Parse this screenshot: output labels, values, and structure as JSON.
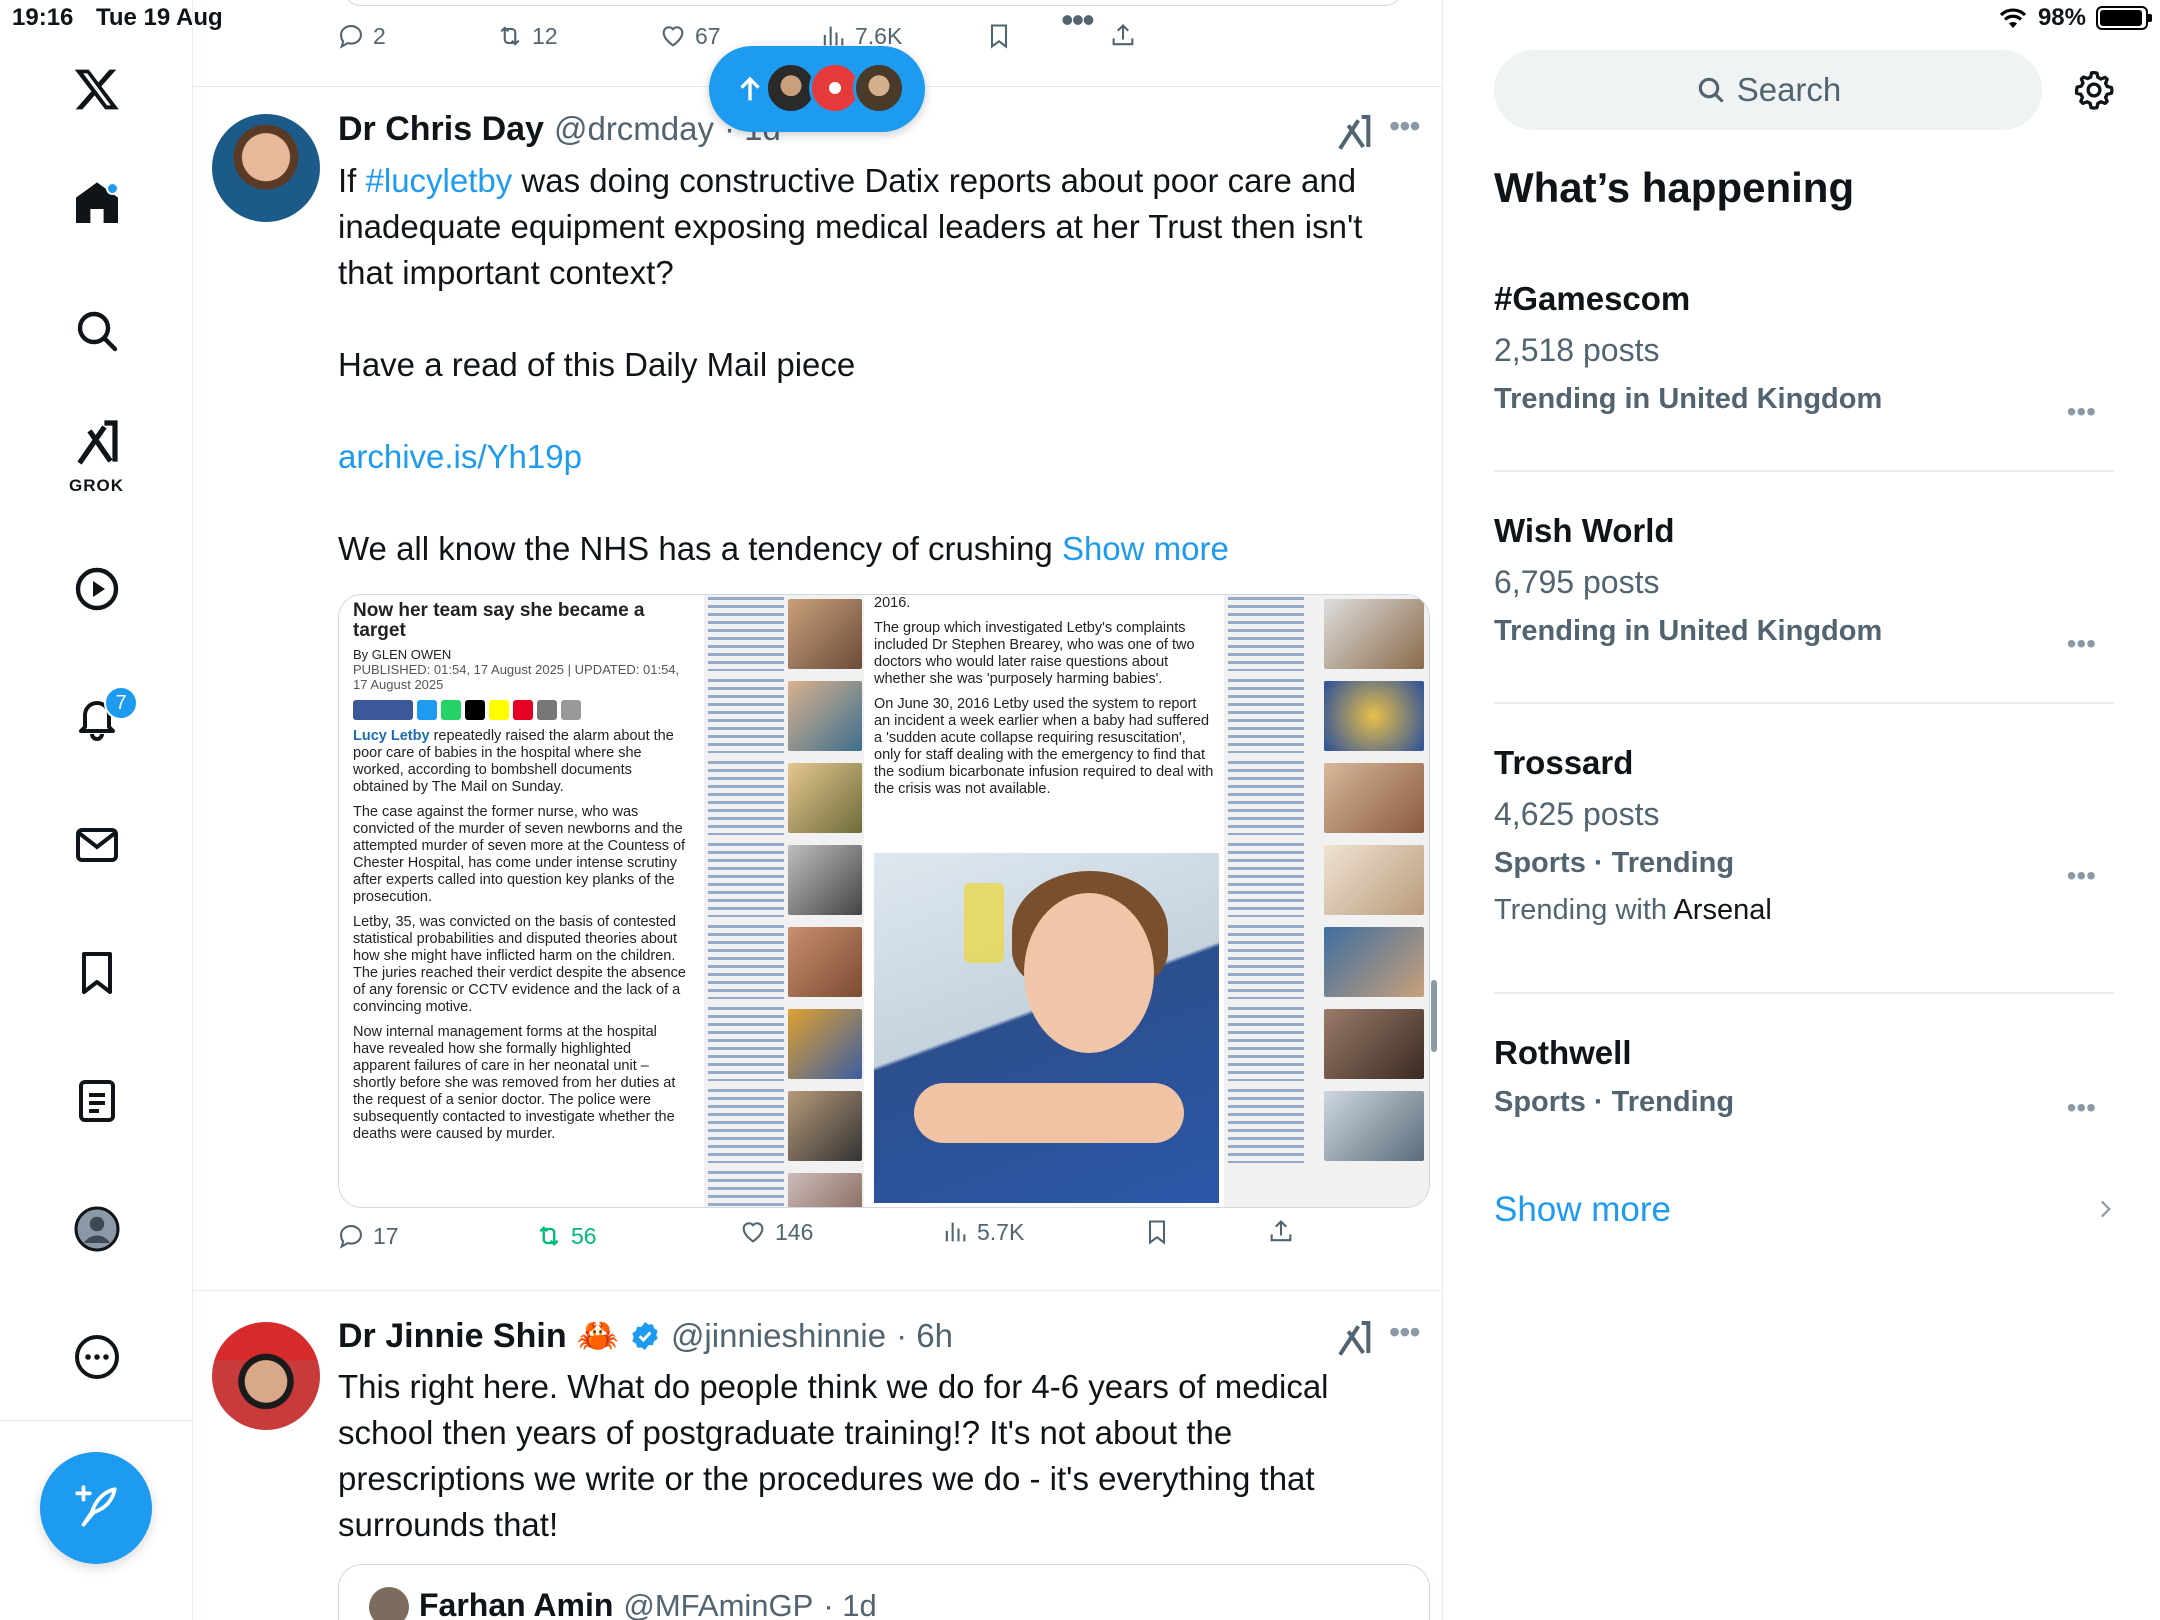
{
  "status_bar": {
    "time": "19:16",
    "date": "Tue 19 Aug",
    "battery": "98%",
    "battery_level": 0.98
  },
  "nav": {
    "grok_label": "GROK",
    "notifications_count": "7",
    "items": [
      "x-logo",
      "home-icon",
      "search-icon",
      "grok-icon",
      "video-icon",
      "bell-icon",
      "mail-icon",
      "bookmark-icon",
      "list-icon",
      "profile-icon",
      "more-icon"
    ]
  },
  "prev_tweet": {
    "replies": "2",
    "reposts": "12",
    "likes": "67",
    "views": "7.6K"
  },
  "tweet1": {
    "name": "Dr Chris Day",
    "handle": "@drcmday",
    "time": "· 1d",
    "text_before_hashtag": "If ",
    "hashtag": "#lucyletby",
    "text_after_hashtag": " was doing constructive Datix reports about poor care and inadequate equipment exposing medical leaders at her Trust then isn't that important context?",
    "para2": "Have a read of this Daily Mail piece",
    "link": "archive.is/Yh19p",
    "para4": "We all know the NHS has a tendency of crushing ",
    "show_more": "Show more",
    "replies": "17",
    "reposts": "56",
    "likes": "146",
    "views": "5.7K",
    "media": {
      "headline": "Now her team say she became a target",
      "byline": "By GLEN OWEN",
      "published": "PUBLISHED: 01:54, 17 August 2025 | UPDATED: 01:54, 17 August 2025",
      "p1_name": "Lucy Letby",
      "p1": " repeatedly raised the alarm about the poor care of babies in the hospital where she worked, according to bombshell documents obtained by The Mail on Sunday.",
      "p2": "The case against the former nurse, who was convicted of the murder of seven newborns and the attempted murder of seven more at the Countess of Chester Hospital, has come under intense scrutiny after experts called into question key planks of the prosecution.",
      "p3": "Letby, 35, was convicted on the basis of contested statistical probabilities and disputed theories about how she might have inflicted harm on the children. The juries reached their verdict despite the absence of any forensic or CCTV evidence and the lack of a convincing motive.",
      "p4": "Now internal management forms at the hospital have revealed how she formally highlighted apparent failures of care in her neonatal unit – shortly before she was removed from her duties at the request of a senior doctor. The police were subsequently contacted to investigate whether the deaths were caused by murder.",
      "col2_p0": "2016.",
      "col2_p1": "The group which investigated Letby's complaints included Dr Stephen Brearey, who was one of two doctors who would later raise questions about whether she was 'purposely harming babies'.",
      "col2_p2": "On June 30, 2016 Letby used the system to report an incident a week earlier when a baby had suffered a 'sudden acute collapse requiring resuscitation', only for staff dealing with the emergency to find that the sodium bicarbonate infusion required to deal with the crisis was not available."
    }
  },
  "tweet2": {
    "name": "Dr Jinnie Shin",
    "emoji": "🦀",
    "handle": "@jinnieshinnie",
    "time": "· 6h",
    "text": "This right here. What do people think we do for 4-6 years of medical school then years of postgraduate training!? It's not about the prescriptions we write or the procedures we do - it's everything that surrounds that!",
    "quote_name": "Farhan Amin",
    "quote_handle": "@MFAminGP",
    "quote_time": "· 1d"
  },
  "sidebar": {
    "search_placeholder": "Search",
    "heading": "What’s happening",
    "trends": [
      {
        "title": "#Gamescom",
        "posts": "2,518 posts",
        "meta": "Trending in United Kingdom"
      },
      {
        "title": "Wish World",
        "posts": "6,795 posts",
        "meta": "Trending in United Kingdom"
      },
      {
        "title": "Trossard",
        "posts": "4,625 posts",
        "meta": "Sports · Trending",
        "with_prefix": "Trending with ",
        "with": "Arsenal"
      },
      {
        "title": "Rothwell",
        "meta": "Sports · Trending"
      }
    ],
    "show_more": "Show more"
  },
  "colors": {
    "accent": "#1d9bf0",
    "repost_active": "#00ba7c",
    "muted": "#536471"
  }
}
